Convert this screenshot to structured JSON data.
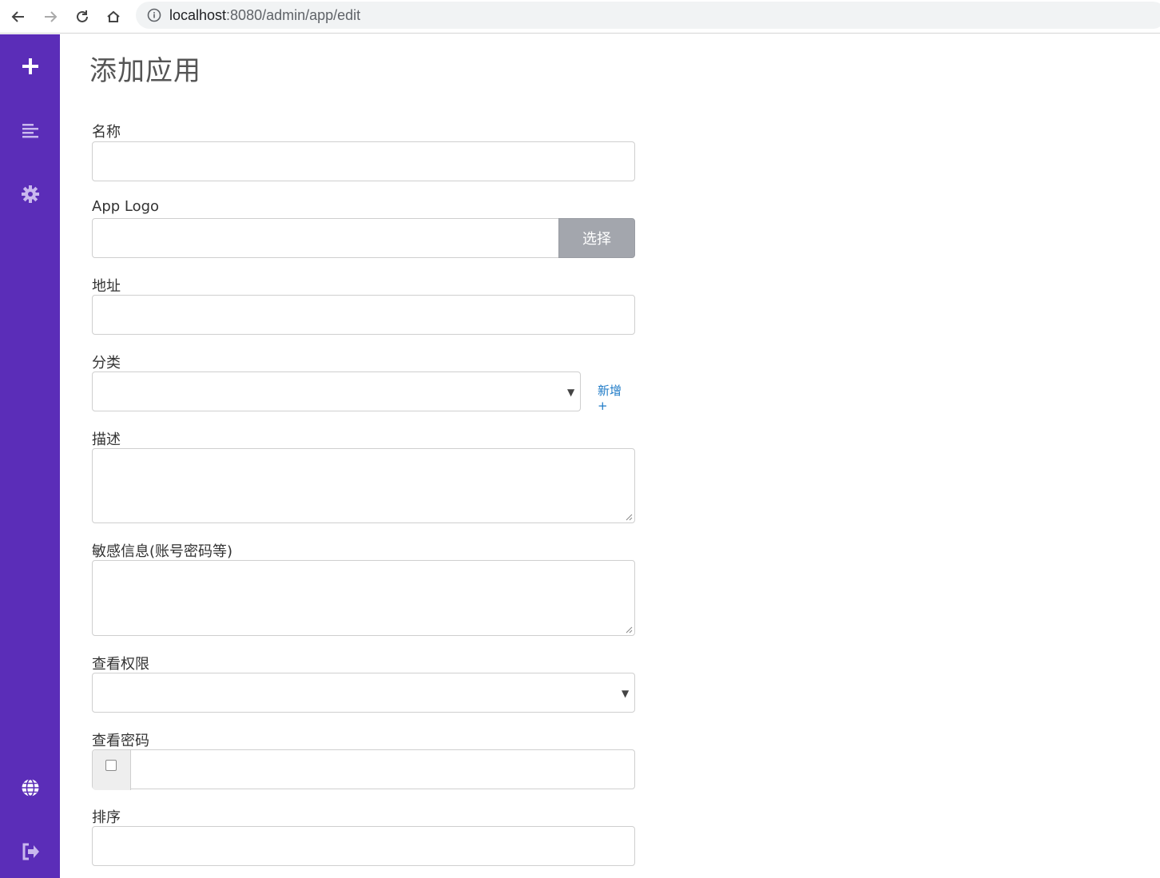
{
  "browser": {
    "url_host": "localhost",
    "url_path": ":8080/admin/app/edit"
  },
  "sidebar": {
    "icons": [
      "plus-icon",
      "list-icon",
      "gear-icon",
      "globe-icon",
      "sign-out-icon"
    ],
    "color": "#5b2db8"
  },
  "page": {
    "title": "添加应用"
  },
  "form": {
    "name": {
      "label": "名称",
      "value": ""
    },
    "logo": {
      "label": "App Logo",
      "value": "",
      "button": "选择"
    },
    "address": {
      "label": "地址",
      "value": ""
    },
    "category": {
      "label": "分类",
      "value": "",
      "add_link": "新增 +"
    },
    "description": {
      "label": "描述",
      "value": ""
    },
    "sensitive": {
      "label": "敏感信息(账号密码等)",
      "value": ""
    },
    "permission": {
      "label": "查看权限",
      "value": ""
    },
    "password": {
      "label": "查看密码",
      "checked": false,
      "value": ""
    },
    "sort": {
      "label": "排序",
      "value": ""
    }
  }
}
